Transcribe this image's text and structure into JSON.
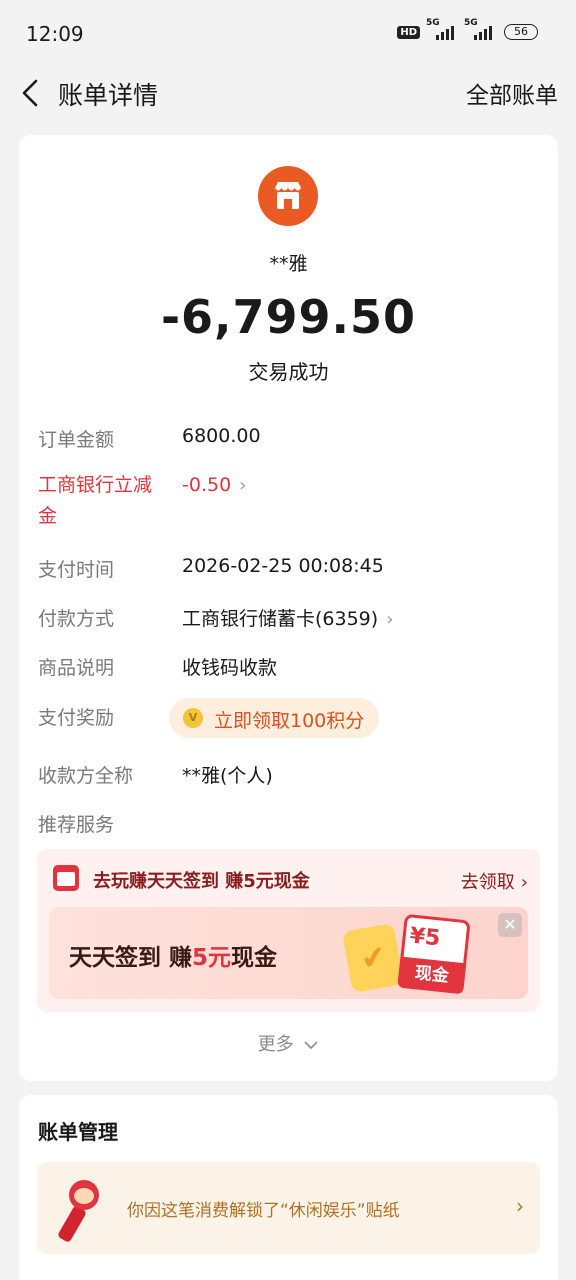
{
  "status_bar": {
    "time": "12:09",
    "hd": "HD",
    "sim1": "5G",
    "sim2": "5G",
    "battery": "56"
  },
  "header": {
    "title": "账单详情",
    "right_link": "全部账单"
  },
  "transaction": {
    "merchant_name": "**雅",
    "amount": "-6,799.50",
    "status": "交易成功"
  },
  "details": {
    "order_amount_label": "订单金额",
    "order_amount_value": "6800.00",
    "discount_label": "工商银行立减金",
    "discount_value": "-0.50",
    "pay_time_label": "支付时间",
    "pay_time_value": "2026-02-25 00:08:45",
    "pay_method_label": "付款方式",
    "pay_method_value": "工商银行储蓄卡(6359)",
    "product_label": "商品说明",
    "product_value": "收钱码收款",
    "reward_label": "支付奖励",
    "reward_value": "立即领取100积分",
    "payee_label": "收款方全称",
    "payee_value": "**雅(个人)",
    "recommend_label": "推荐服务"
  },
  "promo": {
    "title": "去玩赚天天签到 赚5元现金",
    "link": "去领取",
    "banner_text_prefix": "天天签到 赚",
    "banner_text_highlight": "5元",
    "banner_text_suffix": "现金",
    "coupon_amount": "¥5",
    "coupon_label": "现金"
  },
  "more_label": "更多",
  "bill_management": {
    "title": "账单管理",
    "sticker_text": "你因这笔消费解锁了“休闲娱乐”贴纸"
  },
  "colors": {
    "accent_red": "#e2343f",
    "merchant_orange": "#ea5a23",
    "background": "#f3f3f3"
  }
}
